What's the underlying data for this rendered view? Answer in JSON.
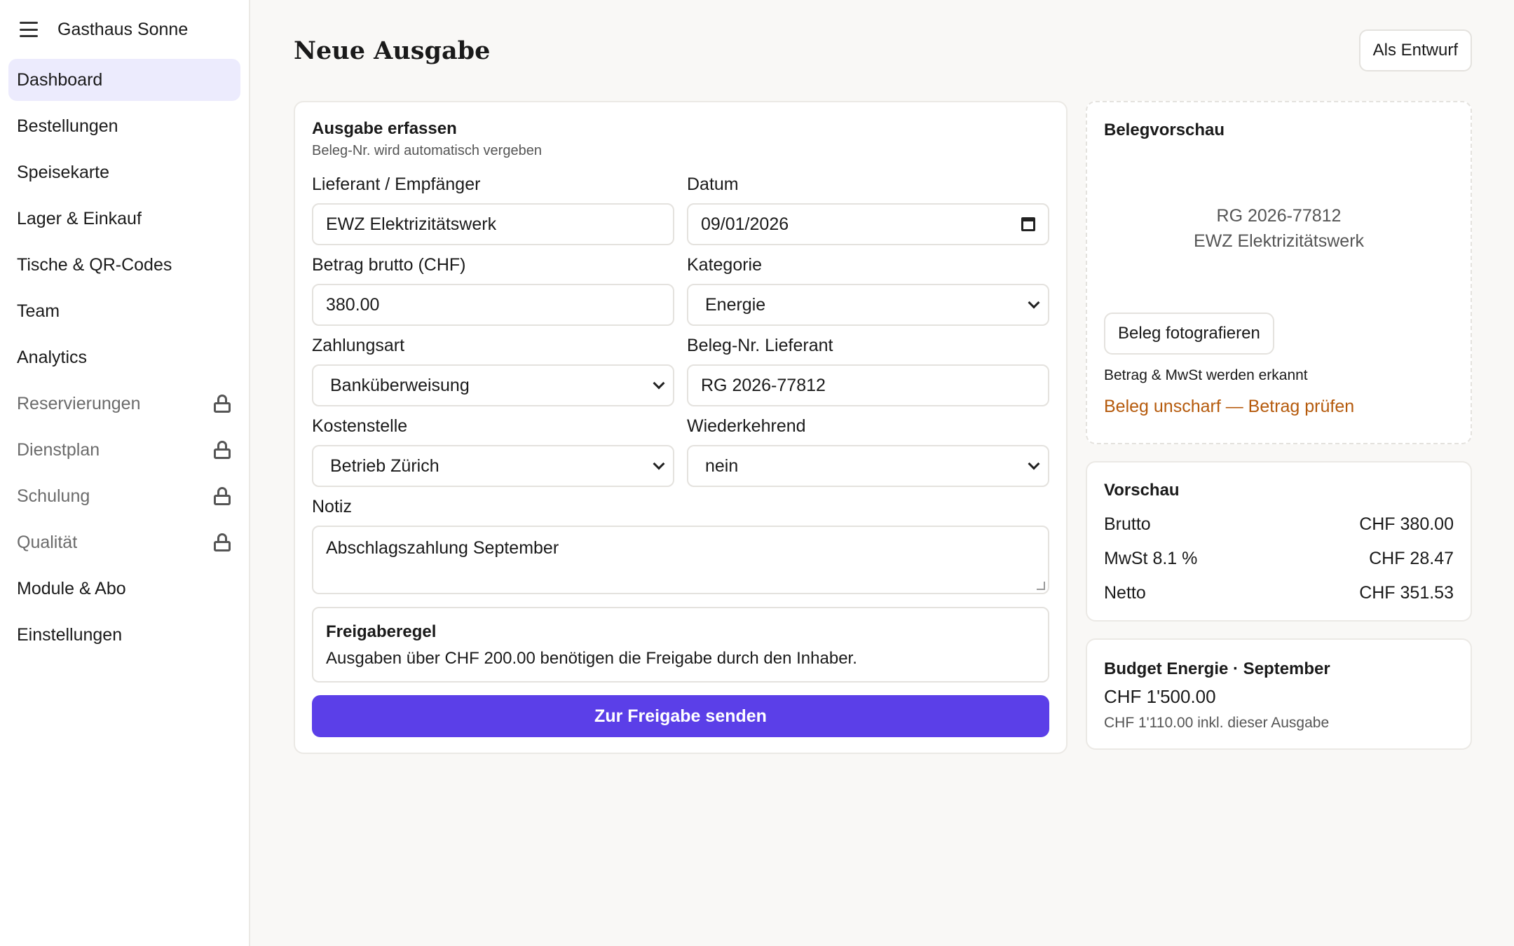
{
  "app": {
    "name": "Gasthaus Sonne"
  },
  "sidebar": {
    "items": [
      {
        "label": "Dashboard",
        "active": true,
        "locked": false
      },
      {
        "label": "Bestellungen",
        "locked": false
      },
      {
        "label": "Speisekarte",
        "locked": false
      },
      {
        "label": "Lager & Einkauf",
        "locked": false
      },
      {
        "label": "Tische & QR-Codes",
        "locked": false
      },
      {
        "label": "Team",
        "locked": false
      },
      {
        "label": "Analytics",
        "locked": false
      },
      {
        "label": "Reservierungen",
        "locked": true
      },
      {
        "label": "Dienstplan",
        "locked": true
      },
      {
        "label": "Schulung",
        "locked": true
      },
      {
        "label": "Qualität",
        "locked": true
      },
      {
        "label": "Module & Abo",
        "locked": false
      },
      {
        "label": "Einstellungen",
        "locked": false
      }
    ]
  },
  "header": {
    "title": "Neue Ausgabe",
    "draft_label": "Als Entwurf"
  },
  "form": {
    "title": "Ausgabe erfassen",
    "subtitle": "Beleg-Nr. wird automatisch vergeben",
    "supplier_label": "Lieferant / Empfänger",
    "supplier_value": "EWZ Elektrizitätswerk",
    "date_label": "Datum",
    "date_value": "09/01/2026",
    "amount_label": "Betrag brutto (CHF)",
    "amount_value": "380.00",
    "category_label": "Kategorie",
    "category_value": "Energie",
    "payment_label": "Zahlungsart",
    "payment_value": "Banküberweisung",
    "receipt_label": "Beleg-Nr. Lieferant",
    "receipt_value": "RG 2026-77812",
    "costcenter_label": "Kostenstelle",
    "costcenter_value": "Betrieb Zürich",
    "recurring_label": "Wiederkehrend",
    "recurring_value": "nein",
    "note_label": "Notiz",
    "note_value": "Abschlagszahlung September",
    "rule_title": "Freigaberegel",
    "rule_text": "Ausgaben über CHF 200.00 benötigen die Freigabe durch den Inhaber.",
    "submit_label": "Zur Freigabe senden"
  },
  "receipt_preview": {
    "title": "Belegvorschau",
    "doc_number": "RG 2026-77812",
    "doc_supplier": "EWZ Elektrizitätswerk",
    "photo_label": "Beleg fotografieren",
    "hint": "Betrag & MwSt werden erkannt",
    "warning": "Beleg unscharf — Betrag prüfen",
    "warning_color": "#b55a0c"
  },
  "summary": {
    "title": "Vorschau",
    "gross_label": "Brutto",
    "gross_value": "CHF 380.00",
    "vat_label": "MwSt 8.1 %",
    "vat_value": "CHF 28.47",
    "net_label": "Netto",
    "net_value": "CHF 351.53"
  },
  "budget": {
    "title": "Budget Energie · September",
    "amount": "CHF 1'500.00",
    "sub": "CHF 1'110.00 inkl. dieser Ausgabe"
  },
  "colors": {
    "accent": "#5b3fe8",
    "active_nav": "#ecebfd"
  }
}
